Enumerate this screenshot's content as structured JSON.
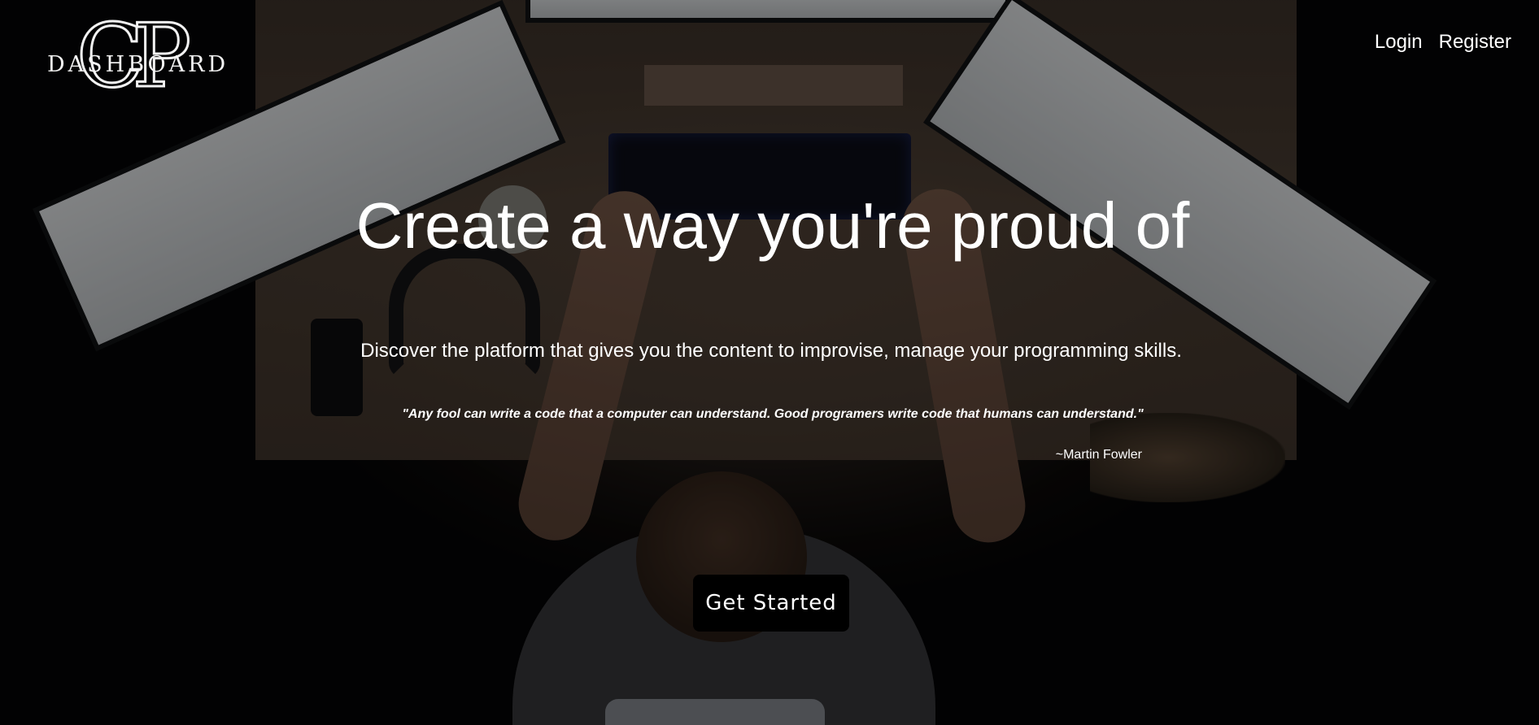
{
  "brand": {
    "monogram": "CP",
    "wordmark": "DASHBOARD"
  },
  "nav": {
    "login": "Login",
    "register": "Register"
  },
  "hero": {
    "headline": "Create a way you're proud of",
    "subhead": "Discover the platform that gives you the content to improvise, manage your programming skills.",
    "quote": "\"Any fool can write a code that a computer can understand. Good programers write code that humans can understand.\"",
    "author": "~Martin Fowler",
    "cta": "Get Started"
  },
  "colors": {
    "text": "#ffffff",
    "button_bg": "#000000"
  }
}
